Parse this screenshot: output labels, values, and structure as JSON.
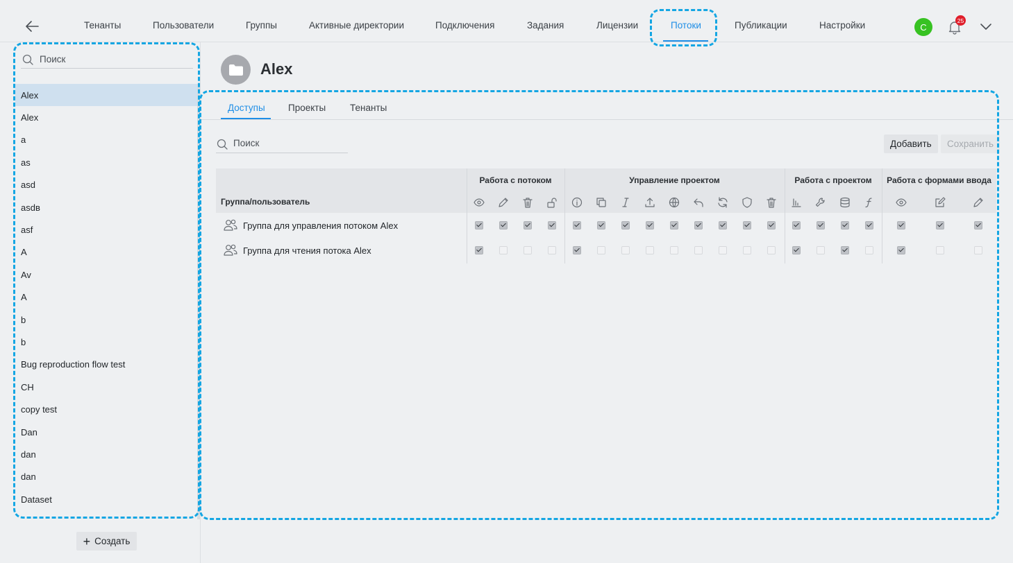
{
  "nav": {
    "items": [
      "Тенанты",
      "Пользователи",
      "Группы",
      "Активные директории",
      "Подключения",
      "Задания",
      "Лицензии",
      "Потоки",
      "Публикации",
      "Настройки"
    ],
    "active": "Потоки",
    "avatar_letter": "C",
    "notification_count": "25"
  },
  "sidebar": {
    "search_placeholder": "Поиск",
    "items": [
      "Alex",
      "Alex",
      "a",
      "as",
      "asd",
      "asdв",
      "asf",
      "А",
      "Av",
      "A",
      "b",
      "b",
      "Bug reproduction flow test",
      "CH",
      "copy test",
      "Dan",
      "dan",
      "dan",
      "Dataset"
    ],
    "selected_index": 0,
    "create_label": "Создать"
  },
  "main": {
    "title": "Alex",
    "tabs": [
      "Доступы",
      "Проекты",
      "Тенанты"
    ],
    "active_tab": "Доступы",
    "search_placeholder": "Поиск",
    "add_label": "Добавить",
    "save_label": "Сохранить",
    "table": {
      "first_column": "Группа/пользователь",
      "groups": [
        {
          "title": "Работа с потоком",
          "icons": [
            "eye-icon",
            "pencil-icon",
            "trash-icon",
            "unlock-icon"
          ]
        },
        {
          "title": "Управление проектом",
          "icons": [
            "info-icon",
            "copy-icon",
            "italic-icon",
            "upload-icon",
            "globe-icon",
            "undo-icon",
            "refresh-icon",
            "shield-icon",
            "trash-icon"
          ]
        },
        {
          "title": "Работа с проектом",
          "icons": [
            "bar-chart-icon",
            "wrench-icon",
            "database-icon",
            "function-icon"
          ]
        },
        {
          "title": "Работа с формами ввода",
          "icons": [
            "eye-icon",
            "edit-icon",
            "pencil-icon"
          ]
        }
      ],
      "rows": [
        {
          "label": "Группа для управления потоком Alex",
          "checks": [
            1,
            1,
            1,
            1,
            1,
            1,
            1,
            1,
            1,
            1,
            1,
            1,
            1,
            1,
            1,
            1,
            1,
            1,
            1,
            1
          ]
        },
        {
          "label": "Группа для чтения потока Alex",
          "checks": [
            1,
            0,
            0,
            0,
            1,
            0,
            0,
            0,
            0,
            0,
            0,
            0,
            0,
            1,
            0,
            1,
            0,
            1,
            0,
            0
          ]
        }
      ]
    }
  },
  "colors": {
    "accent": "#1f8ee6",
    "highlight": "#14a6e3",
    "avatar": "#37c222",
    "badge": "#e01e2b"
  }
}
